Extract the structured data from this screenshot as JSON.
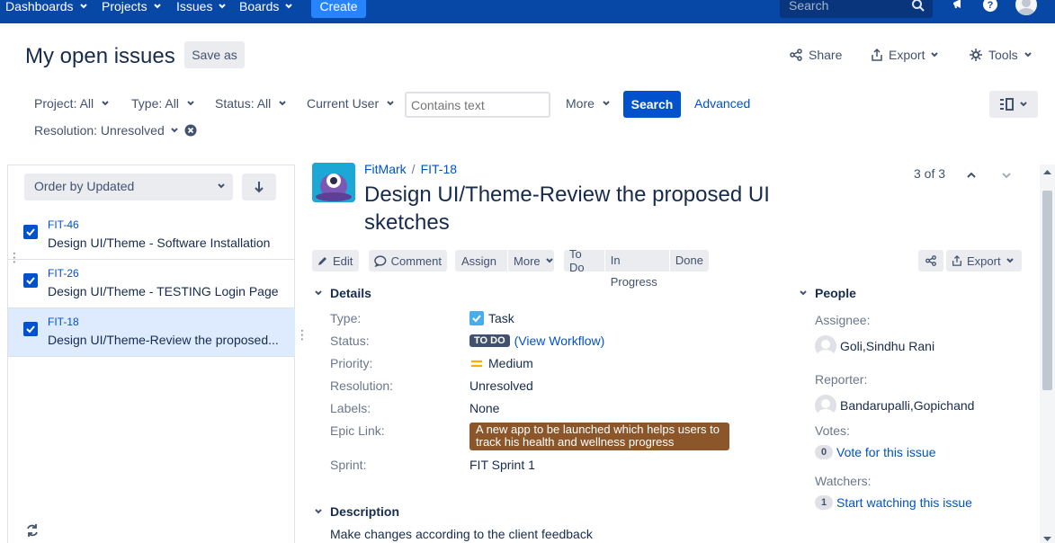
{
  "topnav": {
    "items": [
      {
        "label": "Dashboards"
      },
      {
        "label": "Projects"
      },
      {
        "label": "Issues"
      },
      {
        "label": "Boards"
      }
    ],
    "create_label": "Create",
    "search_placeholder": "Search"
  },
  "header": {
    "title": "My open issues",
    "save_as": "Save as",
    "share": "Share",
    "export": "Export",
    "tools": "Tools"
  },
  "filters": {
    "project": "Project: All",
    "type": "Type: All",
    "status": "Status: All",
    "user": "Current User",
    "text_placeholder": "Contains text",
    "more": "More",
    "search": "Search",
    "advanced": "Advanced",
    "resolution": "Resolution: Unresolved"
  },
  "list": {
    "order_by": "Order by Updated",
    "issues": [
      {
        "key": "FIT-46",
        "summary": "Design UI/Theme - Software Installation"
      },
      {
        "key": "FIT-26",
        "summary": "Design UI/Theme - TESTING Login Page"
      },
      {
        "key": "FIT-18",
        "summary": "Design UI/Theme-Review the proposed..."
      }
    ]
  },
  "issue": {
    "project": "FitMark",
    "key": "FIT-18",
    "title": "Design UI/Theme-Review the proposed UI sketches",
    "pager": "3 of 3",
    "ops": {
      "edit": "Edit",
      "comment": "Comment",
      "assign": "Assign",
      "more": "More",
      "todo": "To Do",
      "in_progress": "In Progress",
      "done": "Done",
      "export": "Export"
    },
    "details": {
      "header": "Details",
      "type_label": "Type:",
      "type_value": "Task",
      "status_label": "Status:",
      "status_value": "TO DO",
      "view_workflow": "(View Workflow)",
      "priority_label": "Priority:",
      "priority_value": "Medium",
      "resolution_label": "Resolution:",
      "resolution_value": "Unresolved",
      "labels_label": "Labels:",
      "labels_value": "None",
      "epic_label": "Epic Link:",
      "epic_value": "A new app to be launched which helps users to track his health and wellness progress",
      "sprint_label": "Sprint:",
      "sprint_value": "FIT Sprint 1"
    },
    "description": {
      "header": "Description",
      "text": "Make changes according to the client feedback"
    },
    "people": {
      "header": "People",
      "assignee_label": "Assignee:",
      "assignee": "Goli,Sindhu Rani",
      "reporter_label": "Reporter:",
      "reporter": "Bandarupalli,Gopichand",
      "votes_label": "Votes:",
      "votes_count": "0",
      "vote_link": "Vote for this issue",
      "watchers_label": "Watchers:",
      "watchers_count": "1",
      "watch_link": "Start watching this issue"
    }
  },
  "colors": {
    "nav": "#0747a6",
    "primary": "#0052cc",
    "epic": "#8b572a"
  }
}
